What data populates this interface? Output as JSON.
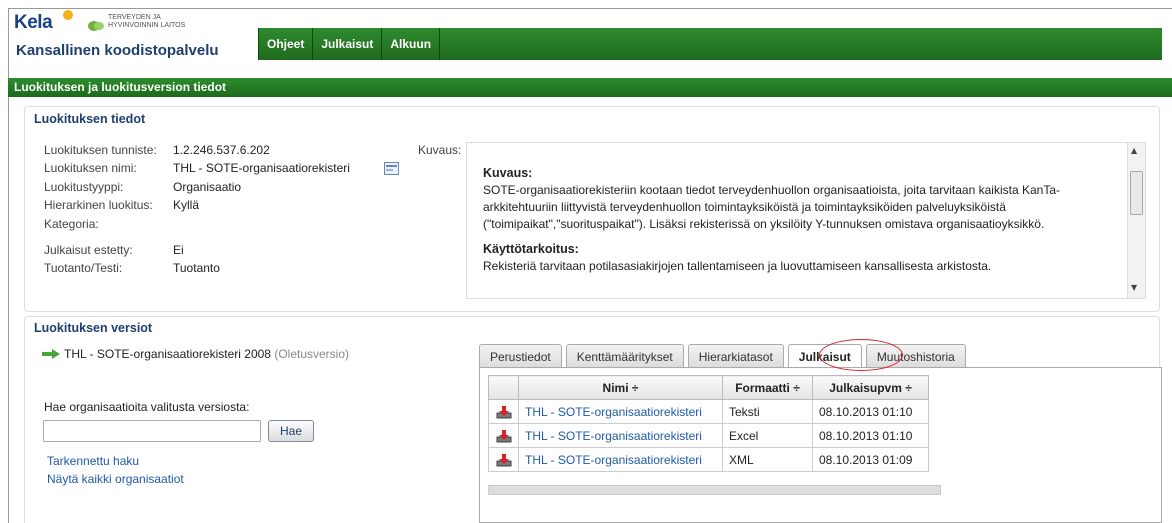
{
  "header": {
    "brand": "Kela",
    "partner_line1": "TERVEYDEN JA",
    "partner_line2": "HYVINVOINNIN LAITOS",
    "app_title": "Kansallinen koodistopalvelu",
    "nav": [
      "Ohjeet",
      "Julkaisut",
      "Alkuun"
    ]
  },
  "section_title": "Luokituksen ja luokitusversion tiedot",
  "info": {
    "title": "Luokituksen tiedot",
    "fields": [
      {
        "label": "Luokituksen tunniste:",
        "value": "1.2.246.537.6.202"
      },
      {
        "label": "Luokituksen nimi:",
        "value": "THL - SOTE-organisaatiorekisteri"
      },
      {
        "label": "Luokitustyyppi:",
        "value": "Organisaatio"
      },
      {
        "label": "Hierarkinen luokitus:",
        "value": "Kyllä"
      },
      {
        "label": "Kategoria:",
        "value": ""
      },
      {
        "label": "Julkaisut estetty:",
        "value": "Ei"
      },
      {
        "label": "Tuotanto/Testi:",
        "value": "Tuotanto"
      }
    ],
    "desc_label": "Kuvaus:",
    "desc_heading": "Kuvaus:",
    "desc_text": "SOTE-organisaatiorekisteriin kootaan tiedot terveydenhuollon organisaatioista, joita tarvitaan kaikista KanTa-arkkitehtuuriin liittyvistä terveydenhuollon toimintayksiköistä ja toimintayksiköiden palveluyksiköistä (\"toimipaikat\",\"suorituspaikat\"). Lisäksi rekisterissä on yksilöity Y-tunnuksen omistava organisaatioyksikkö.",
    "usage_heading": "Käyttötarkoitus:",
    "usage_text": "Rekisteriä tarvitaan potilasasiakirjojen tallentamiseen ja luovuttamiseen kansallisesta arkistosta."
  },
  "versions": {
    "title": "Luokituksen versiot",
    "version_name": "THL - SOTE-organisaatiorekisteri 2008",
    "version_tag": "(Oletusversio)",
    "search_label": "Hae organisaatioita valitusta versiosta:",
    "search_value": "",
    "search_button": "Hae",
    "advanced_link": "Tarkennettu haku",
    "show_all_link": "Näytä kaikki organisaatiot"
  },
  "tabs": [
    {
      "label": "Perustiedot",
      "active": false
    },
    {
      "label": "Kenttämääritykset",
      "active": false
    },
    {
      "label": "Hierarkiatasot",
      "active": false
    },
    {
      "label": "Julkaisut",
      "active": true
    },
    {
      "label": "Muutoshistoria",
      "active": false
    }
  ],
  "table": {
    "headers": [
      "",
      "Nimi ÷",
      "Formaatti ÷",
      "Julkaisupvm ÷"
    ],
    "rows": [
      {
        "name": "THL - SOTE-organisaatiorekisteri",
        "format": "Teksti",
        "date": "08.10.2013 01:10"
      },
      {
        "name": "THL - SOTE-organisaatiorekisteri",
        "format": "Excel",
        "date": "08.10.2013 01:10"
      },
      {
        "name": "THL - SOTE-organisaatiorekisteri",
        "format": "XML",
        "date": "08.10.2013 01:09"
      }
    ]
  },
  "colors": {
    "green_bar": "#1f6b1f",
    "link": "#1f5aa8",
    "highlight_circle": "#d9232a"
  }
}
